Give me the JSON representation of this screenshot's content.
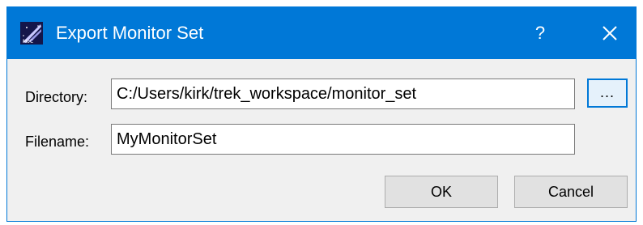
{
  "window": {
    "title": "Export Monitor Set",
    "help_label": "?",
    "app_icon": "app-icon"
  },
  "form": {
    "directory_label": "Directory:",
    "directory_value": "C:/Users/kirk/trek_workspace/monitor_set",
    "browse_label": "...",
    "filename_label": "Filename:",
    "filename_value": "MyMonitorSet"
  },
  "buttons": {
    "ok_label": "OK",
    "cancel_label": "Cancel"
  },
  "colors": {
    "titlebar": "#0078d7",
    "dialog_bg": "#f0f0f0",
    "button_bg": "#e1e1e1",
    "focus_border": "#0078d7"
  }
}
